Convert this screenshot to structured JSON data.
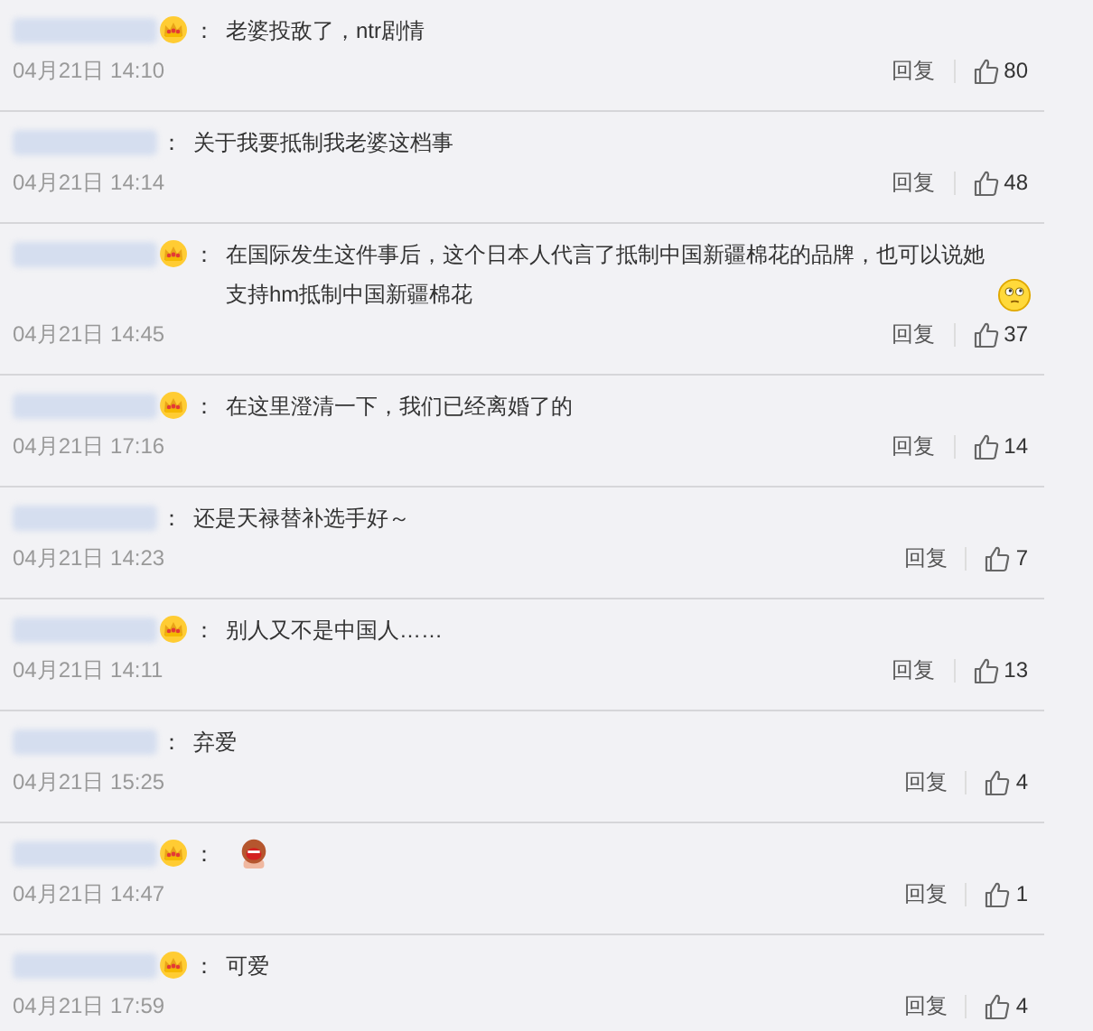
{
  "comments": [
    {
      "vip": true,
      "separator": "：",
      "text": "老婆投敌了，ntr剧情",
      "time": "04月21日 14:10",
      "reply": "回复",
      "likes": "80"
    },
    {
      "vip": false,
      "separator": "：",
      "text": "关于我要抵制我老婆这档事",
      "time": "04月21日 14:14",
      "reply": "回复",
      "likes": "48"
    },
    {
      "vip": true,
      "separator": "：",
      "text": "在国际发生这件事后，这个日本人代言了抵制中国新疆棉花的品牌，也可以说她支持hm抵制中国新疆棉花",
      "emoji": {
        "kind": "thinking"
      },
      "time": "04月21日 14:45",
      "reply": "回复",
      "likes": "37"
    },
    {
      "vip": true,
      "separator": "：",
      "text": "在这里澄清一下，我们已经离婚了的",
      "time": "04月21日 17:16",
      "reply": "回复",
      "likes": "14"
    },
    {
      "vip": false,
      "separator": "：",
      "text": "还是天禄替补选手好～",
      "time": "04月21日 14:23",
      "reply": "回复",
      "likes": "7"
    },
    {
      "vip": true,
      "separator": "：",
      "text": "别人又不是中国人……",
      "time": "04月21日 14:11",
      "reply": "回复",
      "likes": "13"
    },
    {
      "vip": false,
      "separator": "：",
      "text": "弃爱",
      "time": "04月21日 15:25",
      "reply": "回复",
      "likes": "4"
    },
    {
      "vip": true,
      "separator": "：",
      "emoji": {
        "kind": "laughing"
      },
      "time": "04月21日 14:47",
      "reply": "回复",
      "likes": "1"
    },
    {
      "vip": true,
      "separator": "：",
      "text": "可爱",
      "time": "04月21日 17:59",
      "reply": "回复",
      "likes": "4"
    }
  ]
}
